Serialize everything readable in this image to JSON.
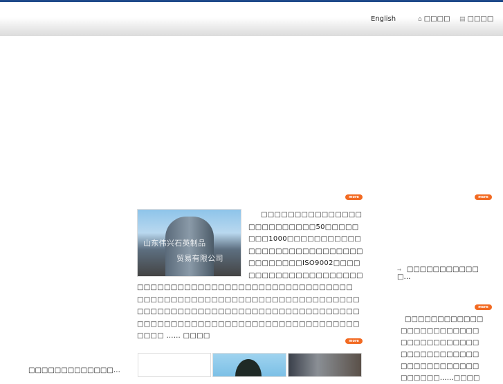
{
  "header": {
    "english": "English",
    "home": "□□□□",
    "favorite": "□□□□"
  },
  "more_label": "more",
  "intro": {
    "image_caption_line1": "山东伟兴石英制品",
    "image_caption_line2": "贸易有限公司",
    "text": "□□□□□□□□□□□□□□□□□□□□□□□□□50□□□□□□□□1000□□□□□□□□□□□□□□□□□□□□□□□□□□□□□□□□□□□□ISO9002□□□□□□□□□□□□□□□□□□□□□□□□□□□□□□□□□□□□□□□□□□□□□□□□□□□□□　□□□□□□□□□□□□□□□□□□□□□□□□□□□□□□□□□□□□□□□□□□□□□□□□□□□□□□□□□□□□□□□□□□□□□□□□□□□□□□□□□□□□□□□□□□□□□□□□□□□□□□□",
    "ellipsis": "……",
    "more_link": "□□□□"
  },
  "side_link": "□□□□□□□□□□□□…",
  "left_link": "□□□□□□□□□□□□□…",
  "contact": {
    "text": "□□□□□□□□□□□□□□□□□□□□□□□□□□□□□□□□□□□□□□□□□□□□□□□□□□□□□□□□□□□□□□□□□□",
    "ellipsis": "……",
    "more_link": "□□□□"
  }
}
